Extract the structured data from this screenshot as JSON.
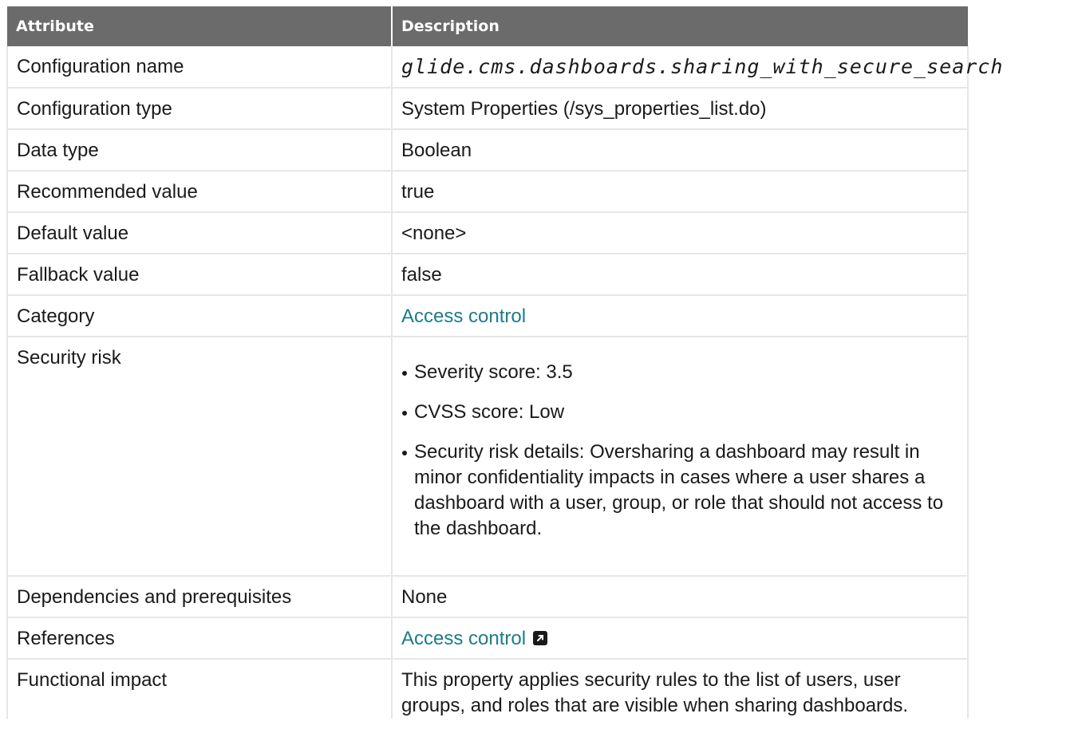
{
  "headers": {
    "attribute": "Attribute",
    "description": "Description"
  },
  "rows": [
    {
      "attribute": "Configuration name",
      "value": "glide.cms.dashboards.sharing_with_secure_search"
    },
    {
      "attribute": "Configuration type",
      "value": "System Properties (/sys_properties_list.do)"
    },
    {
      "attribute": "Data type",
      "value": "Boolean"
    },
    {
      "attribute": "Recommended value",
      "value": "true"
    },
    {
      "attribute": "Default value",
      "value": "<none>"
    },
    {
      "attribute": "Fallback value",
      "value": "false"
    },
    {
      "attribute": "Category",
      "value": "Access control"
    },
    {
      "attribute": "Security risk",
      "bullets": [
        "Severity score: 3.5",
        "CVSS score: Low",
        "Security risk details: Oversharing a dashboard may result in minor confidentiality impacts in cases where a user shares a dashboard with a user, group, or role that should not access to the dashboard."
      ]
    },
    {
      "attribute": "Dependencies and prerequisites",
      "value": "None"
    },
    {
      "attribute": "References",
      "value": "Access control"
    },
    {
      "attribute": "Functional impact",
      "value": "This property applies security rules to the list of users, user groups, and roles that are visible when sharing dashboards."
    }
  ],
  "colors": {
    "header_bg": "#6b6b6b",
    "link": "#1d7b8a",
    "border": "#e6e6e6"
  },
  "icons": {
    "external_link": "external-link-icon"
  }
}
